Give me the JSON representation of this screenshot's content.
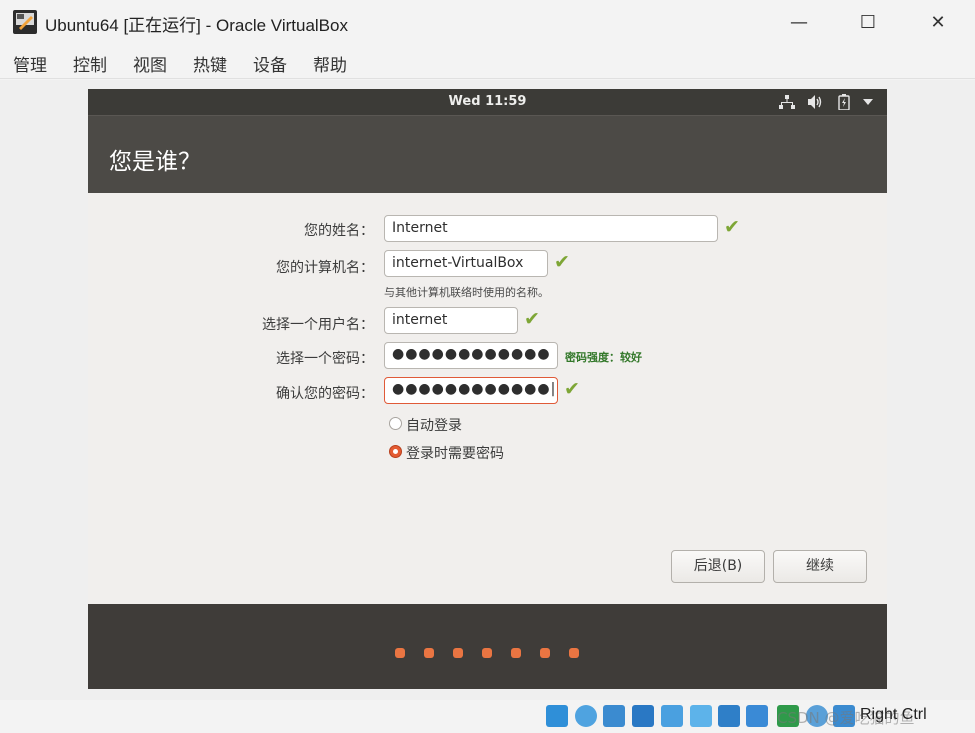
{
  "window": {
    "title": "Ubuntu64 [正在运行] - Oracle VirtualBox",
    "minimize_glyph": "—",
    "maximize_glyph": "☐",
    "close_glyph": "✕"
  },
  "menu": [
    "管理",
    "控制",
    "视图",
    "热键",
    "设备",
    "帮助"
  ],
  "guest": {
    "clock": "Wed 11:59",
    "tray_icons": [
      "network-icon",
      "volume-icon",
      "battery-icon",
      "menu-arrow-icon"
    ],
    "header_title": "您是谁？",
    "form": {
      "name_label": "您的姓名：",
      "name_value": "Internet",
      "computer_label": "您的计算机名：",
      "computer_value": "internet-VirtualBox",
      "computer_hint": "与其他计算机联络时使用的名称。",
      "username_label": "选择一个用户名：",
      "username_value": "internet",
      "password_label": "选择一个密码：",
      "password_value": "●●●●●●●●●●●●",
      "password_strength": "密码强度：较好",
      "confirm_label": "确认您的密码：",
      "confirm_value": "●●●●●●●●●●●●|",
      "check_glyph": "✔"
    },
    "login_options": {
      "auto_login": "自动登录",
      "require_password": "登录时需要密码",
      "selected": "require_password"
    },
    "buttons": {
      "back": "后退(B)",
      "continue": "继续"
    },
    "progress_dots": 7
  },
  "statusbar": {
    "host_key": "Right Ctrl",
    "watermark": "CSDN @爱吃猫的鱼"
  },
  "colors": {
    "accent": "#e45b32",
    "header_bg": "#4c4a46",
    "check": "#7ea636"
  }
}
